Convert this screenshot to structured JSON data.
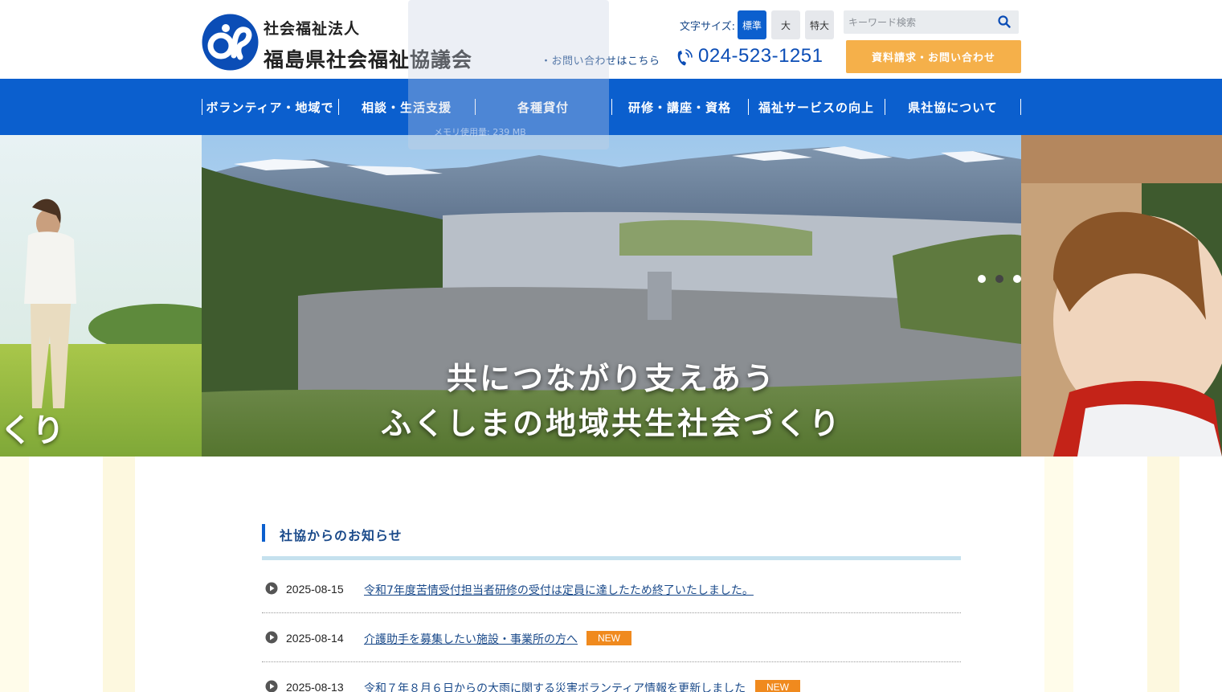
{
  "header": {
    "org_type": "社会福祉法人",
    "org_name": "福島県社会福祉協議会",
    "font_size_label": "文字サイズ:",
    "font_sizes": [
      "標準",
      "大",
      "特大"
    ],
    "search_placeholder": "キーワード検索",
    "inquiry_link": "・お問い合わせはこちら",
    "phone": "024-523-1251",
    "request_button": "資料請求・お問い合わせ",
    "colors": {
      "accent": "#0b5fce",
      "request": "#f5b04a",
      "new_badge": "#f08a1e"
    }
  },
  "overlay": {
    "memory_text": "メモリ使用量: 239 MB"
  },
  "nav": {
    "items": [
      "ボランティア・地域で",
      "相談・生活支援",
      "各種貸付",
      "研修・講座・資格",
      "福祉サービスの向上",
      "県社協について"
    ]
  },
  "hero": {
    "line1": "共につながり支えあう",
    "line2": "ふくしまの地域共生社会づくり",
    "side_text": "くり",
    "slides_total": 3,
    "active_slide": 2
  },
  "news": {
    "section_title": "社協からのお知らせ",
    "items": [
      {
        "date": "2025-08-15",
        "title": "令和7年度苦情受付担当者研修の受付は定員に達したため終了いたしました。",
        "badge": ""
      },
      {
        "date": "2025-08-14",
        "title": "介護助手を募集したい施設・事業所の方へ",
        "badge": "NEW"
      },
      {
        "date": "2025-08-13",
        "title": "令和７年８月６日からの大雨に関する災害ボランティア情報を更新しました",
        "badge": "NEW"
      }
    ]
  }
}
